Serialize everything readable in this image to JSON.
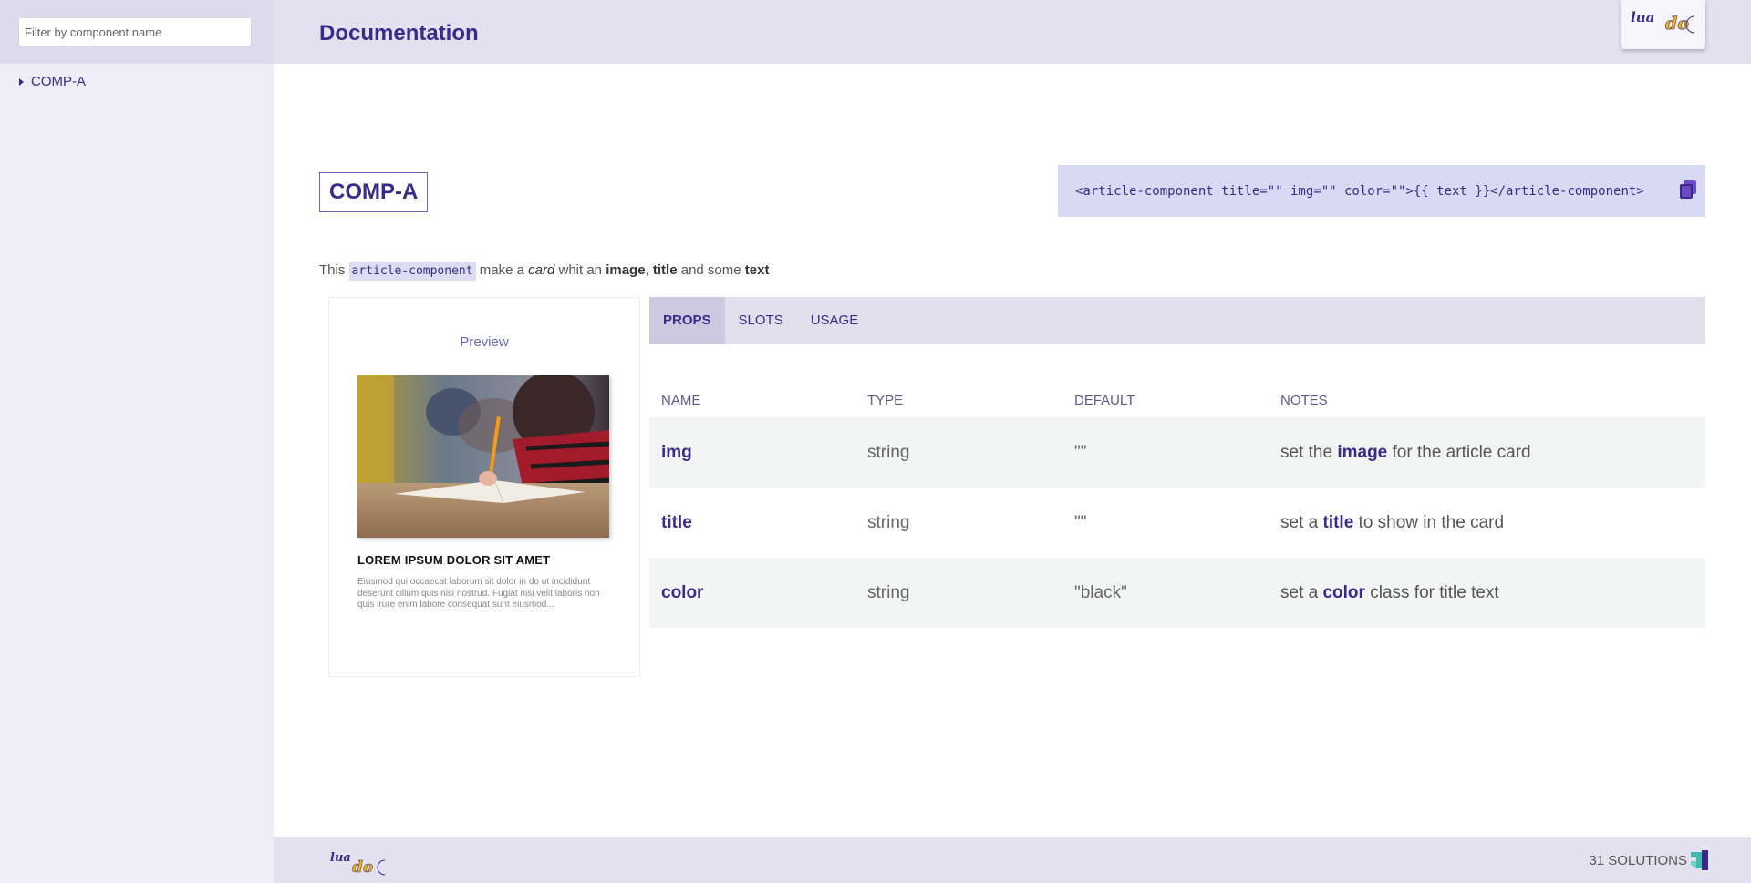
{
  "sidebar": {
    "filter_placeholder": "Filter by component name",
    "items": [
      {
        "label": "COMP-A"
      }
    ]
  },
  "header": {
    "title": "Documentation",
    "logo": {
      "text_top": "lua",
      "text_bottom": "do"
    }
  },
  "component": {
    "title": "COMP-A",
    "usage_code": "<article-component title=\"\" img=\"\" color=\"\">{{ text }}</article-component>",
    "description": {
      "prefix": "This",
      "code": "article-component",
      "part1": "make a",
      "italic": "card",
      "part2": "whit an",
      "bold1": "image",
      "sep": ",",
      "bold2": "title",
      "part3": "and some",
      "bold3": "text"
    }
  },
  "preview": {
    "label": "Preview",
    "card_title": "LOREM IPSUM DOLOR SIT AMET",
    "card_text": "Eiusmod qui occaecat laborum sit dolor in do ut incididunt deserunt cillum quis nisi nostrud. Fugiat nisi velit laboris non quis irure enim labore consequat sunt eiusmod..."
  },
  "tabs": [
    {
      "label": "PROPS",
      "active": true
    },
    {
      "label": "SLOTS",
      "active": false
    },
    {
      "label": "USAGE",
      "active": false
    }
  ],
  "props_table": {
    "headers": [
      "NAME",
      "TYPE",
      "DEFAULT",
      "NOTES"
    ],
    "rows": [
      {
        "name": "img",
        "type": "string",
        "default": "\"\"",
        "notes_pre": "set the",
        "notes_bold": "image",
        "notes_post": "for the article card"
      },
      {
        "name": "title",
        "type": "string",
        "default": "\"\"",
        "notes_pre": "set a",
        "notes_bold": "title",
        "notes_post": "to show in the card"
      },
      {
        "name": "color",
        "type": "string",
        "default": "\"black\"",
        "notes_pre": "set a",
        "notes_bold": "color",
        "notes_post": "class for title text"
      }
    ]
  },
  "footer": {
    "brand": "31 SOLUTIONS",
    "logo": {
      "text_top": "lua",
      "text_bottom": "do"
    }
  },
  "colors": {
    "accent": "#3b2a8a",
    "logo_yellow": "#f2b705",
    "sidebar_bg": "#efedf8",
    "header_bg": "#e3e1ee"
  }
}
